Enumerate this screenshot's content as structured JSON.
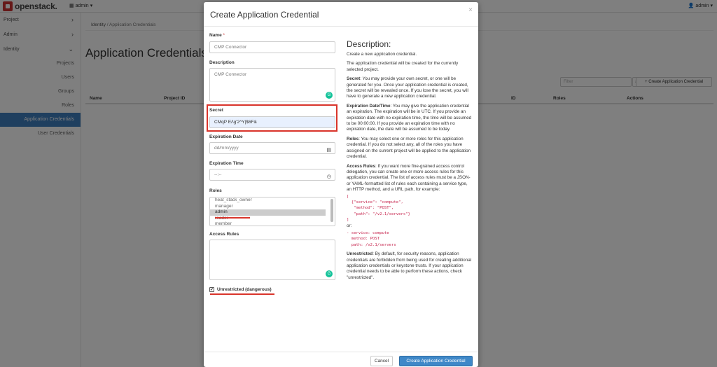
{
  "brand": {
    "name": "openstack."
  },
  "topbar": {
    "project": "admin",
    "user": "admin"
  },
  "sidebar": {
    "items": [
      {
        "label": "Project"
      },
      {
        "label": "Admin"
      },
      {
        "label": "Identity"
      }
    ],
    "sub_items": [
      {
        "label": "Projects"
      },
      {
        "label": "Users"
      },
      {
        "label": "Groups"
      },
      {
        "label": "Roles"
      },
      {
        "label": "Application Credentials"
      },
      {
        "label": "User Credentials"
      }
    ]
  },
  "main": {
    "breadcrumb": [
      "Identity",
      "Application Credentials"
    ],
    "title": "Application Credentials",
    "filter_placeholder": "Filter",
    "create_button": "+ Create Application Credential",
    "columns": [
      "Name",
      "Project ID",
      "ID",
      "Roles",
      "Actions"
    ]
  },
  "modal": {
    "title": "Create Application Credential",
    "close": "×",
    "name_label": "Name",
    "name_required": "*",
    "name_value": "CMP Connector",
    "description_label": "Description",
    "description_value": "CMP Connector",
    "secret_label": "Secret",
    "secret_value": "CMqP E/\\g'2^Y|$6F&",
    "expiration_date_label": "Expiration Date",
    "expiration_date_placeholder": "dd/mm/yyyy",
    "expiration_time_label": "Expiration Time",
    "expiration_time_placeholder": "--:--",
    "roles_label": "Roles",
    "roles": [
      "heat_stack_owner",
      "manager",
      "admin",
      "reader",
      "member"
    ],
    "roles_selected": "admin",
    "access_rules_label": "Access Rules",
    "unrestricted_label": "Unrestricted (dangerous)",
    "unrestricted_checked": true,
    "cancel_button": "Cancel",
    "create_button": "Create Application Credential"
  },
  "help": {
    "title": "Description:",
    "intro": "Create a new application credential.",
    "project_note": "The application credential will be created for the currently selected project.",
    "secret_heading": "Secret",
    "secret_text": ": You may provide your own secret, or one will be generated for you. Once your application credential is created, the secret will be revealed once. If you lose the secret, you will have to generate a new application credential.",
    "expiration_heading": "Expiration Date/Time",
    "expiration_text": ": You may give the application credential an expiration. The expiration will be in UTC. If you provide an expiration date with no expiration time, the time will be assumed to be 00:00:00. If you provide an expiration time with no expiration date, the date will be assumed to be today.",
    "roles_heading": "Roles",
    "roles_text": ": You may select one or more roles for this application credential. If you do not select any, all of the roles you have assigned on the current project will be applied to the application credential.",
    "access_heading": "Access Rules",
    "access_text": ": If you want more fine-grained access control delegation, you can create one or more access rules for this application credential. The list of access rules must be a JSON- or YAML-formatted list of rules each containing a service type, an HTTP method, and a URL path, for example:",
    "json_example": "[\n  {\"service\": \"compute\",\n   \"method\": \"POST\",\n   \"path\": \"/v2.1/servers\"}\n]",
    "or_text": "or:",
    "yaml_example": "- service: compute\n  method: POST\n  path: /v2.1/servers",
    "unrestricted_heading": "Unrestricted",
    "unrestricted_text": ": By default, for security reasons, application credentials are forbidden from being used for creating additional application credentials or keystone trusts. If your application credential needs to be able to perform these actions, check \"unrestricted\"."
  },
  "colors": {
    "accent": "#3f88c8",
    "highlight": "#d9342b",
    "active_nav": "#3f7fbf"
  }
}
